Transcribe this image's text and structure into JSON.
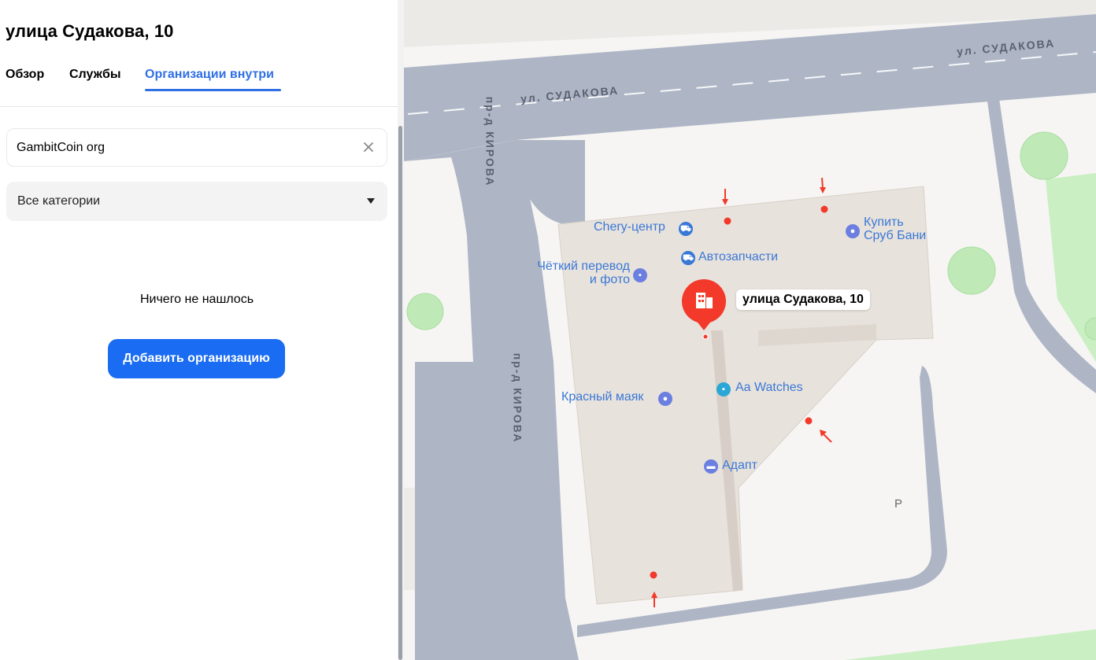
{
  "panel": {
    "title": "улица Судакова, 10",
    "tabs": [
      {
        "label": "Обзор",
        "active": false
      },
      {
        "label": "Службы",
        "active": false
      },
      {
        "label": "Организации внутри",
        "active": true
      }
    ],
    "search": {
      "value": "GambitCoin org",
      "placeholder": ""
    },
    "category": {
      "selected": "Все категории"
    },
    "empty_message": "Ничего не нашлось",
    "add_button_label": "Добавить организацию"
  },
  "map": {
    "streets": {
      "sudakova_left": "ул. СУДАКОВА",
      "sudakova_right": "ул. СУДАКОВА",
      "kirova_top": "пр-д КИРОВА",
      "kirova_bottom": "пр-д КИРОВА"
    },
    "pois": {
      "chery": "Chery-центр",
      "autoparts": "Автозапчасти",
      "kupit_line1": "Купить",
      "kupit_line2": "Сруб Бани",
      "photo_line1": "Чёткий перевод",
      "photo_line2": "и фото",
      "watches": "Aa Watches",
      "krasny": "Красный маяк",
      "adapt": "Адапт",
      "parking": "P"
    },
    "address_tooltip": "улица Судакова, 10"
  },
  "colors": {
    "accent": "#2f6fe4",
    "button": "#1a6cf2",
    "marker": "#f2392a",
    "road": "#aeb6c6",
    "building": "#e8e2dc",
    "greenery": "#c9efc3"
  }
}
